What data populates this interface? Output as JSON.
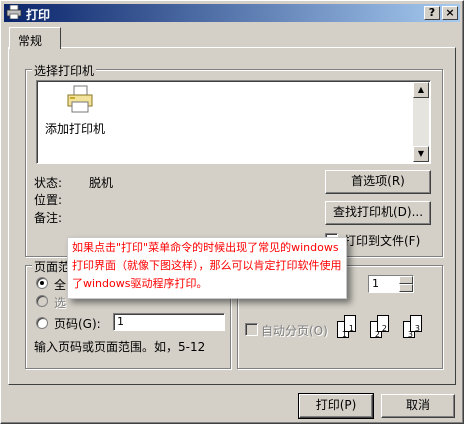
{
  "window": {
    "title": "打印",
    "help_label": "?",
    "close_label": "×"
  },
  "tabs": [
    {
      "label": "常规"
    }
  ],
  "select_printer": {
    "legend": "选择打印机",
    "items": [
      {
        "label": "添加打印机",
        "icon": "printer-add-icon"
      }
    ],
    "status_label": "状态:",
    "status_value": "脱机",
    "location_label": "位置:",
    "comment_label": "备注:",
    "preferences_button": "首选项(R)",
    "find_printer_button": "查找打印机(D)...",
    "print_to_file_label": "打印到文件(F)"
  },
  "page_range": {
    "legend": "页面范",
    "all_label": "全",
    "selection_label": "选",
    "pages_label": "页码(G):",
    "pages_value": "1",
    "hint": "输入页码或页面范围。如，5-12"
  },
  "copies": {
    "value": "1",
    "collate_label": "自动分页(O)",
    "collate_checked": false,
    "collate_pages": [
      "1",
      "1",
      "2",
      "2",
      "3",
      "3"
    ]
  },
  "callout": {
    "text": "如果点击\"打印\"菜单命令的时候出现了常见的windows打印界面（就像下图这样），那么可以肯定打印软件使用了windows驱动程序打印。"
  },
  "footer": {
    "print_button": "打印(P)",
    "cancel_button": "取消"
  },
  "colors": {
    "title_gradient_start": "#0a246a",
    "title_gradient_end": "#a6caf0",
    "face": "#d4d0c8",
    "callout_text": "#ff0000"
  }
}
